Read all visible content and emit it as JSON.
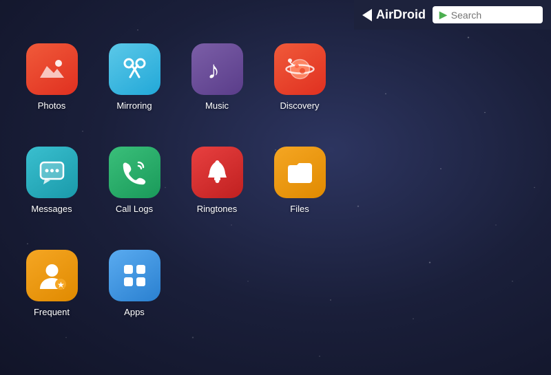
{
  "topbar": {
    "logo_text": "AirDroid",
    "search_placeholder": "Search"
  },
  "apps": [
    {
      "id": "photos",
      "label": "Photos",
      "icon": "photos",
      "row": 1,
      "col": 1
    },
    {
      "id": "mirroring",
      "label": "Mirroring",
      "icon": "mirroring",
      "row": 1,
      "col": 2
    },
    {
      "id": "music",
      "label": "Music",
      "icon": "music",
      "row": 1,
      "col": 3
    },
    {
      "id": "discovery",
      "label": "Discovery",
      "icon": "discovery",
      "row": 1,
      "col": 4
    },
    {
      "id": "messages",
      "label": "Messages",
      "icon": "messages",
      "row": 2,
      "col": 1
    },
    {
      "id": "calllogs",
      "label": "Call Logs",
      "icon": "calllogs",
      "row": 2,
      "col": 2
    },
    {
      "id": "ringtones",
      "label": "Ringtones",
      "icon": "ringtones",
      "row": 2,
      "col": 3
    },
    {
      "id": "files",
      "label": "Files",
      "icon": "files",
      "row": 3,
      "col": 1
    },
    {
      "id": "frequent",
      "label": "Frequent",
      "icon": "frequent",
      "row": 3,
      "col": 2
    },
    {
      "id": "apps",
      "label": "Apps",
      "icon": "apps",
      "row": 3,
      "col": 3
    }
  ]
}
